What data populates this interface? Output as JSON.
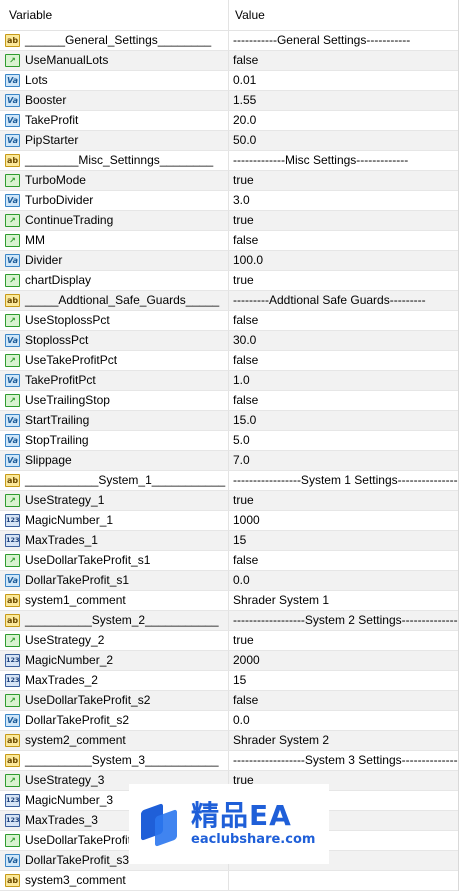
{
  "header": {
    "variable": "Variable",
    "value": "Value"
  },
  "rows": [
    {
      "type": "ab",
      "name": "______General_Settings________",
      "value": "-----------General Settings-----------"
    },
    {
      "type": "bool",
      "name": "UseManualLots",
      "value": "false"
    },
    {
      "type": "dbl",
      "name": "Lots",
      "value": "0.01"
    },
    {
      "type": "dbl",
      "name": "Booster",
      "value": "1.55"
    },
    {
      "type": "dbl",
      "name": "TakeProfit",
      "value": "20.0"
    },
    {
      "type": "dbl",
      "name": "PipStarter",
      "value": "50.0"
    },
    {
      "type": "ab",
      "name": "________Misc_Settinngs________",
      "value": "-------------Misc Settings-------------"
    },
    {
      "type": "bool",
      "name": "TurboMode",
      "value": "true"
    },
    {
      "type": "dbl",
      "name": "TurboDivider",
      "value": "3.0"
    },
    {
      "type": "bool",
      "name": "ContinueTrading",
      "value": "true"
    },
    {
      "type": "bool",
      "name": "MM",
      "value": "false"
    },
    {
      "type": "dbl",
      "name": "Divider",
      "value": "100.0"
    },
    {
      "type": "bool",
      "name": "chartDisplay",
      "value": "true"
    },
    {
      "type": "ab",
      "name": "_____Addtional_Safe_Guards_____",
      "value": "---------Addtional Safe Guards---------"
    },
    {
      "type": "bool",
      "name": "UseStoplossPct",
      "value": "false"
    },
    {
      "type": "dbl",
      "name": "StoplossPct",
      "value": "30.0"
    },
    {
      "type": "bool",
      "name": "UseTakeProfitPct",
      "value": "false"
    },
    {
      "type": "dbl",
      "name": "TakeProfitPct",
      "value": "1.0"
    },
    {
      "type": "bool",
      "name": "UseTrailingStop",
      "value": "false"
    },
    {
      "type": "dbl",
      "name": "StartTrailing",
      "value": "15.0"
    },
    {
      "type": "dbl",
      "name": "StopTrailing",
      "value": "5.0"
    },
    {
      "type": "dbl",
      "name": "Slippage",
      "value": "7.0"
    },
    {
      "type": "ab",
      "name": "___________System_1___________",
      "value": "-----------------System 1 Settings-----------------"
    },
    {
      "type": "bool",
      "name": "UseStrategy_1",
      "value": "true"
    },
    {
      "type": "int",
      "name": "MagicNumber_1",
      "value": "1000"
    },
    {
      "type": "int",
      "name": "MaxTrades_1",
      "value": "15"
    },
    {
      "type": "bool",
      "name": "UseDollarTakeProfit_s1",
      "value": "false"
    },
    {
      "type": "dbl",
      "name": "DollarTakeProfit_s1",
      "value": "0.0"
    },
    {
      "type": "ab",
      "name": "system1_comment",
      "value": "Shrader System 1"
    },
    {
      "type": "ab",
      "name": "__________System_2___________",
      "value": "------------------System 2 Settings------------------"
    },
    {
      "type": "bool",
      "name": "UseStrategy_2",
      "value": "true"
    },
    {
      "type": "int",
      "name": "MagicNumber_2",
      "value": "2000"
    },
    {
      "type": "int",
      "name": "MaxTrades_2",
      "value": "15"
    },
    {
      "type": "bool",
      "name": "UseDollarTakeProfit_s2",
      "value": "false"
    },
    {
      "type": "dbl",
      "name": "DollarTakeProfit_s2",
      "value": "0.0"
    },
    {
      "type": "ab",
      "name": "system2_comment",
      "value": "Shrader System 2"
    },
    {
      "type": "ab",
      "name": "__________System_3___________",
      "value": "------------------System 3 Settings------------------"
    },
    {
      "type": "bool",
      "name": "UseStrategy_3",
      "value": "true"
    },
    {
      "type": "int",
      "name": "MagicNumber_3",
      "value": ""
    },
    {
      "type": "int",
      "name": "MaxTrades_3",
      "value": ""
    },
    {
      "type": "bool",
      "name": "UseDollarTakeProfit_s3",
      "value": ""
    },
    {
      "type": "dbl",
      "name": "DollarTakeProfit_s3",
      "value": ""
    },
    {
      "type": "ab",
      "name": "system3_comment",
      "value": ""
    }
  ],
  "icon_glyphs": {
    "ab": "ab",
    "bool": "↗",
    "dbl": "Va",
    "int": "123"
  },
  "watermark": {
    "title": "精品EA",
    "url": "eaclubshare.com"
  }
}
